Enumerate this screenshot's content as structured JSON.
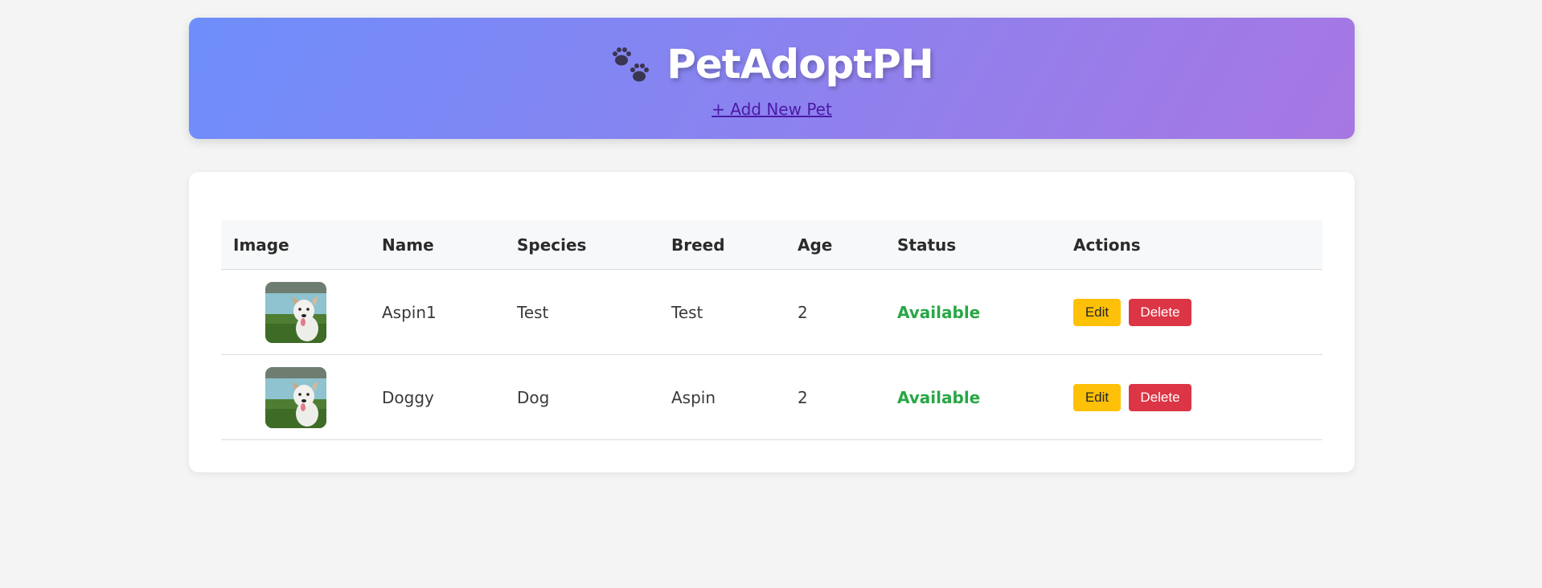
{
  "header": {
    "title": "PetAdoptPH",
    "logo_icon": "paw-prints-icon",
    "add_link": "+ Add New Pet"
  },
  "table": {
    "columns": [
      "Image",
      "Name",
      "Species",
      "Breed",
      "Age",
      "Status",
      "Actions"
    ],
    "rows": [
      {
        "image_icon": "dog-photo",
        "name": "Aspin1",
        "species": "Test",
        "breed": "Test",
        "age": "2",
        "status": "Available",
        "edit": "Edit",
        "delete": "Delete"
      },
      {
        "image_icon": "dog-photo",
        "name": "Doggy",
        "species": "Dog",
        "breed": "Aspin",
        "age": "2",
        "status": "Available",
        "edit": "Edit",
        "delete": "Delete"
      }
    ]
  },
  "colors": {
    "gradient_start": "#6e8efb",
    "gradient_end": "#a777e3",
    "status_available": "#28a745",
    "edit_button": "#ffc107",
    "delete_button": "#dc3545"
  }
}
